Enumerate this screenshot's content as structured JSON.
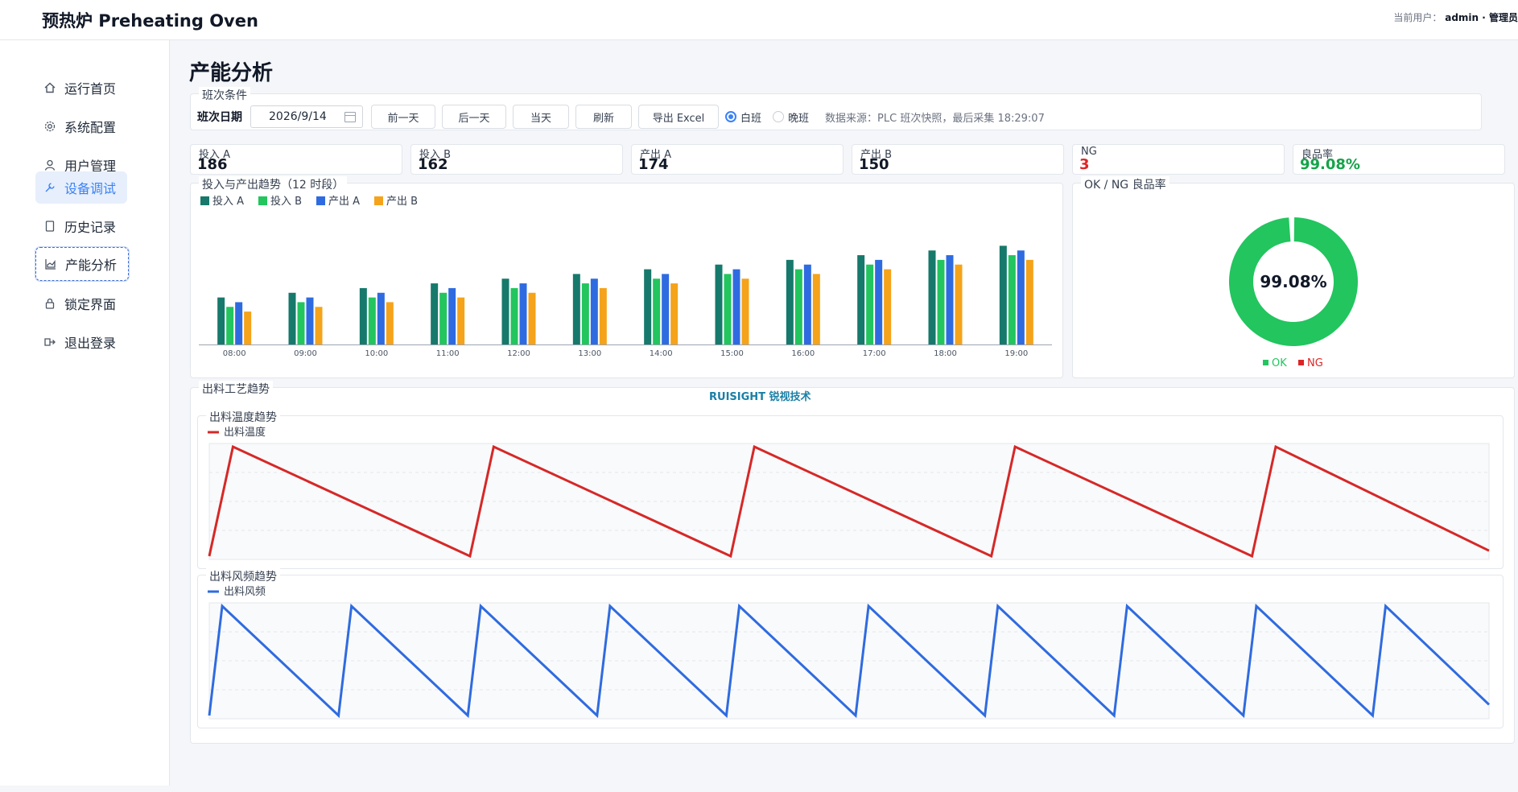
{
  "app": {
    "title": "预热炉 Preheating Oven",
    "user_label": "当前用户：",
    "user_name": "admin · 管理员"
  },
  "sidebar": {
    "items": [
      {
        "label": "运行首页",
        "icon": "home-icon"
      },
      {
        "label": "系统配置",
        "icon": "gear-icon"
      },
      {
        "label": "用户管理",
        "icon": "user-icon"
      },
      {
        "label": "设备调试",
        "icon": "wrench-icon"
      },
      {
        "label": "历史记录",
        "icon": "document-icon"
      },
      {
        "label": "产能分析",
        "icon": "chart-icon"
      },
      {
        "label": "锁定界面",
        "icon": "lock-icon"
      },
      {
        "label": "退出登录",
        "icon": "logout-icon"
      }
    ],
    "active_index": 3,
    "focused_index": 5
  },
  "page": {
    "title": "产能分析"
  },
  "filter": {
    "legend": "班次条件",
    "date_label": "班次日期",
    "date_value": "2026/9/14",
    "prev_day": "前一天",
    "next_day": "后一天",
    "today": "当天",
    "refresh": "刷新",
    "export": "导出 Excel",
    "shift_day": "白班",
    "shift_night": "晚班",
    "selected_shift": "白班",
    "source": "数据来源：PLC 班次快照，最后采集 18:29:07"
  },
  "kpis": [
    {
      "label": "投入 A",
      "value": "186"
    },
    {
      "label": "投入 B",
      "value": "162"
    },
    {
      "label": "产出 A",
      "value": "174"
    },
    {
      "label": "产出 B",
      "value": "150"
    },
    {
      "label": "NG",
      "value": "3"
    },
    {
      "label": "良品率",
      "value": "99.08%"
    }
  ],
  "colors": {
    "input_a": "#16796b",
    "input_b": "#22c55e",
    "output_a": "#2f6be0",
    "output_b": "#f5a31a",
    "ok": "#22c55e",
    "ng": "#dc2626",
    "temp": "#d62828",
    "fan": "#2f6be0",
    "accent": "#3b82f6"
  },
  "chart_data": [
    {
      "type": "bar",
      "title": "投入与产出趋势（12 时段）",
      "categories": [
        "08:00",
        "09:00",
        "10:00",
        "11:00",
        "12:00",
        "13:00",
        "14:00",
        "15:00",
        "16:00",
        "17:00",
        "18:00",
        "19:00"
      ],
      "series": [
        {
          "name": "投入 A",
          "values": [
            10,
            11,
            12,
            13,
            14,
            15,
            16,
            17,
            18,
            19,
            20,
            21
          ]
        },
        {
          "name": "投入 B",
          "values": [
            8,
            9,
            10,
            11,
            12,
            13,
            14,
            15,
            16,
            17,
            18,
            19
          ]
        },
        {
          "name": "产出 A",
          "values": [
            9,
            10,
            11,
            12,
            13,
            14,
            15,
            16,
            17,
            18,
            19,
            20
          ]
        },
        {
          "name": "产出 B",
          "values": [
            7,
            8,
            9,
            10,
            11,
            12,
            13,
            14,
            15,
            16,
            17,
            18
          ]
        }
      ],
      "ylim": [
        0,
        25
      ],
      "grid": false,
      "legend": "top-left"
    },
    {
      "type": "pie",
      "title": "OK / NG 良品率",
      "labels": [
        "OK",
        "NG"
      ],
      "values": [
        99.08,
        0.92
      ],
      "center_label": "99.08%",
      "legend": "bottom"
    },
    {
      "type": "line",
      "title": "出料温度趋势",
      "series": [
        {
          "name": "出料温度",
          "x": [
            0,
            1,
            11,
            12,
            22,
            23,
            33,
            34,
            44,
            45,
            54
          ],
          "values": [
            0,
            100,
            0,
            100,
            0,
            100,
            0,
            100,
            0,
            100,
            5
          ]
        }
      ],
      "xlim": [
        0,
        54
      ],
      "ylim": [
        0,
        100
      ],
      "grid": true,
      "legend": "top-left"
    },
    {
      "type": "line",
      "title": "出料风频趋势",
      "series": [
        {
          "name": "出料风频",
          "x": [
            0,
            1,
            10,
            11,
            20,
            21,
            30,
            31,
            40,
            41,
            50,
            51,
            60,
            61,
            70,
            71,
            80,
            81,
            90,
            91,
            99
          ],
          "values": [
            0,
            100,
            0,
            100,
            0,
            100,
            0,
            100,
            0,
            100,
            0,
            100,
            0,
            100,
            0,
            100,
            0,
            100,
            0,
            100,
            10
          ]
        }
      ],
      "xlim": [
        0,
        99
      ],
      "ylim": [
        0,
        100
      ],
      "grid": true,
      "legend": "top-left"
    }
  ],
  "process": {
    "legend": "出料工艺趋势",
    "logo_text": "RUISIGHT 锐视技术"
  }
}
